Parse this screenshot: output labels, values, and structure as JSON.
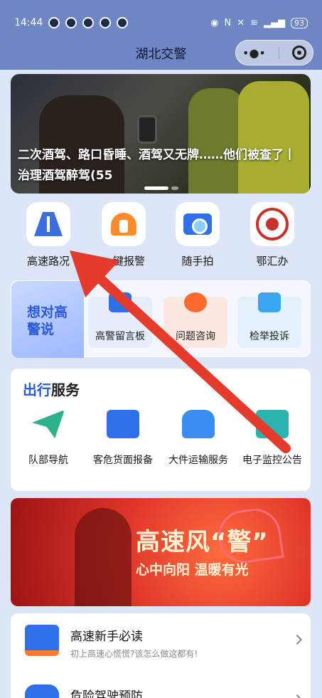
{
  "status_bar": {
    "time": "14:44",
    "battery": "93"
  },
  "header": {
    "title": "湖北交警"
  },
  "banner": {
    "caption": "二次酒驾、路口昏睡、酒驾又无牌……他们被查了丨治理酒驾醉驾(55"
  },
  "quick_links": [
    {
      "label": "高速路况",
      "icon": "highway-road-icon"
    },
    {
      "label": "一键报警",
      "icon": "alarm-icon"
    },
    {
      "label": "随手拍",
      "icon": "camera-icon"
    },
    {
      "label": "鄂汇办",
      "icon": "ehuiban-logo-icon"
    }
  ],
  "consult": {
    "title": "想对高警说",
    "cards": [
      {
        "label": "高警留言板",
        "icon": "message-board-icon"
      },
      {
        "label": "问题咨询",
        "icon": "headset-icon"
      },
      {
        "label": "检举投诉",
        "icon": "mail-icon"
      }
    ]
  },
  "travel": {
    "title_highlight": "出行",
    "title_rest": "服务",
    "items": [
      {
        "label": "队部导航",
        "icon": "navigation-icon"
      },
      {
        "label": "客危货面报备",
        "icon": "truck-icon"
      },
      {
        "label": "大件运输服务",
        "icon": "car-icon"
      },
      {
        "label": "电子监控公告",
        "icon": "monitor-notice-icon"
      }
    ]
  },
  "promo": {
    "title": "高速风“警”",
    "subtitle": "心中向阳 温暖有光"
  },
  "list": [
    {
      "title": "高速新手必读",
      "subtitle": "初上高速心慌慌?该怎么做这都有!",
      "icon": "book-icon"
    },
    {
      "title": "危险驾驶预防",
      "subtitle": "",
      "icon": "car-warning-icon"
    }
  ],
  "colors": {
    "accent": "#2a59d8",
    "arrow": "#e53b2c"
  }
}
